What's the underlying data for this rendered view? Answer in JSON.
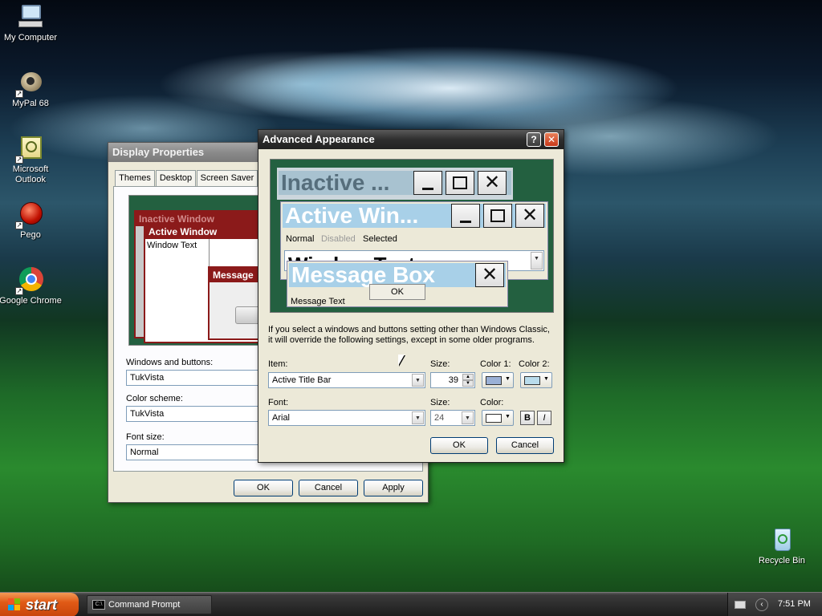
{
  "desktop": {
    "icons": [
      {
        "label": "My Computer",
        "icon": "computer-icon"
      },
      {
        "label": "MyPal 68",
        "icon": "mypal-icon"
      },
      {
        "label": "Microsoft Outlook",
        "icon": "outlook-icon"
      },
      {
        "label": "Pego",
        "icon": "pego-icon"
      },
      {
        "label": "Google Chrome",
        "icon": "chrome-icon"
      },
      {
        "label": "Recycle Bin",
        "icon": "recycle-bin-icon"
      }
    ]
  },
  "display_properties": {
    "title": "Display Properties",
    "tabs": [
      "Themes",
      "Desktop",
      "Screen Saver"
    ],
    "preview": {
      "inactive": "Inactive Window",
      "active": "Active Window",
      "window_text": "Window Text",
      "message": "Message"
    },
    "windows_buttons_label": "Windows and buttons:",
    "windows_buttons_value": "TukVista",
    "color_scheme_label": "Color scheme:",
    "color_scheme_value": "TukVista",
    "font_size_label": "Font size:",
    "font_size_value": "Normal",
    "ok": "OK",
    "cancel": "Cancel",
    "apply": "Apply"
  },
  "advanced": {
    "title": "Advanced Appearance",
    "help": "?",
    "preview": {
      "inactive": "Inactive ...",
      "active": "Active Win...",
      "menu": [
        "Normal",
        "Disabled",
        "Selected"
      ],
      "window_text": "Window Text",
      "message_box": "Message Box",
      "message_text": "Message Text",
      "ok": "OK"
    },
    "info_line1": "If you select a windows and buttons setting other than Windows Classic,",
    "info_line2": "it will override the following settings, except in some older programs.",
    "item_label": "Item:",
    "item_value": "Active Title Bar",
    "size_label": "Size:",
    "item_size": "39",
    "color1_label": "Color 1:",
    "color2_label": "Color 2:",
    "font_label": "Font:",
    "font_value": "Arial",
    "font_size_label": "Size:",
    "font_size": "24",
    "color_label": "Color:",
    "bold": "B",
    "italic": "I",
    "ok": "OK",
    "cancel": "Cancel"
  },
  "taskbar": {
    "start": "start",
    "task": "Command Prompt",
    "task_icon": "C:\\",
    "clock": "7:51 PM"
  },
  "colors": {
    "active_title": "#a8d0e8",
    "color1": "#9ab0d6",
    "color2": "#b9dcec",
    "preview_bg": "#236040",
    "inactive_red": "#8b1a1a"
  }
}
